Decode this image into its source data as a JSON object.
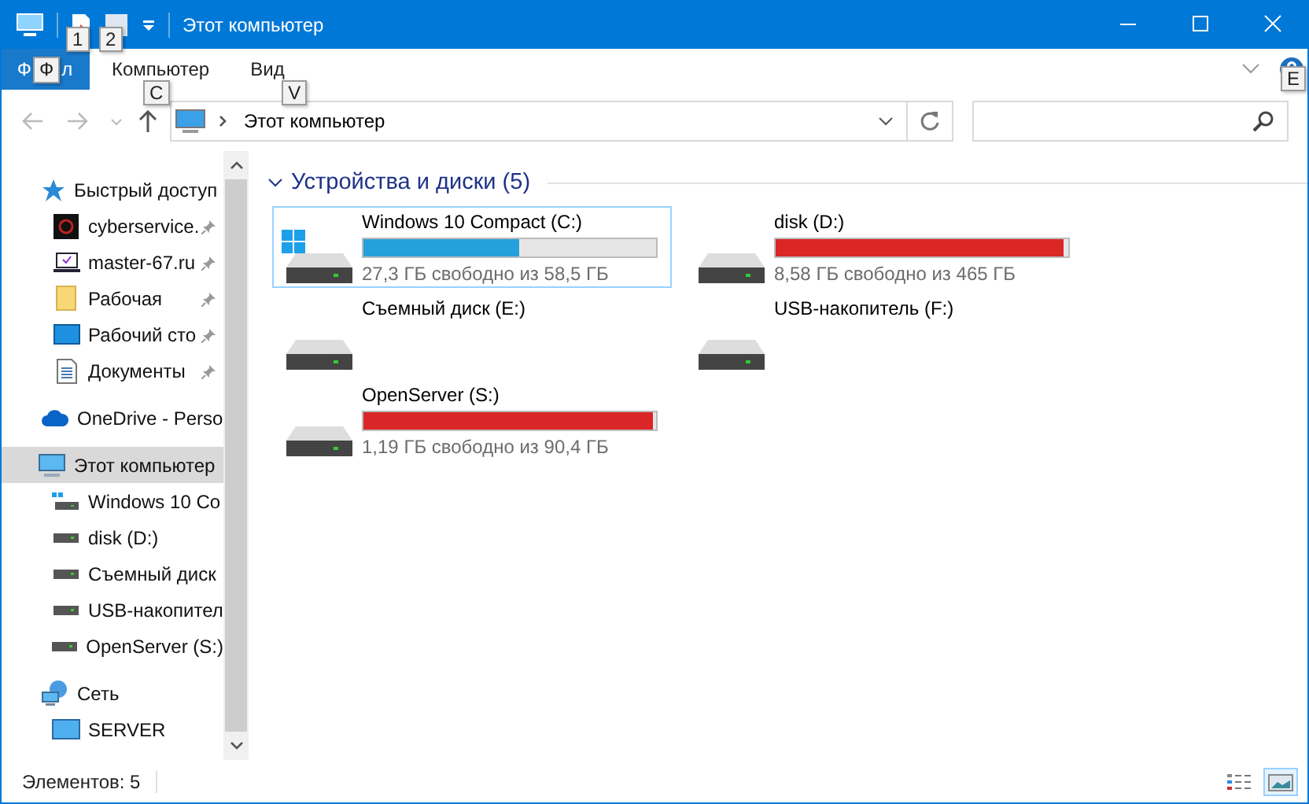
{
  "window": {
    "title": "Этот компьютер"
  },
  "quick_access_toolbar": [
    {
      "kind": "properties",
      "keytip": "1"
    },
    {
      "kind": "new-folder",
      "keytip": "2"
    }
  ],
  "ribbon": {
    "tabs": [
      {
        "kind": "file",
        "label_start": "Ф",
        "keytip": "Ф",
        "label_end": "л"
      },
      {
        "kind": "tab",
        "label": "Компьютер",
        "keytip": "C"
      },
      {
        "kind": "tab",
        "label": "Вид",
        "keytip": "V"
      }
    ],
    "help_keytip": "E"
  },
  "address": {
    "path": "Этот компьютер"
  },
  "navigation": [
    {
      "kind": "quick-access",
      "label": "Быстрый доступ",
      "selected": false,
      "children": [
        {
          "kind": "site",
          "label": "cyberservice.",
          "pinned": true
        },
        {
          "kind": "laptop",
          "label": "master-67.ru",
          "pinned": true
        },
        {
          "kind": "folder",
          "label": "Рабочая",
          "pinned": true
        },
        {
          "kind": "desktop",
          "label": "Рабочий сто",
          "pinned": true
        },
        {
          "kind": "documents",
          "label": "Документы",
          "pinned": true
        }
      ]
    },
    {
      "kind": "onedrive",
      "label": "OneDrive - Perso",
      "selected": false
    },
    {
      "kind": "pc",
      "label": "Этот компьютер",
      "selected": true,
      "children": [
        {
          "kind": "drive-windows",
          "label": "Windows 10 Co",
          "pinned": false
        },
        {
          "kind": "drive",
          "label": "disk (D:)",
          "pinned": false
        },
        {
          "kind": "drive",
          "label": "Съемный диск",
          "pinned": false
        },
        {
          "kind": "drive",
          "label": "USB-накопител",
          "pinned": false
        },
        {
          "kind": "drive",
          "label": "OpenServer (S:)",
          "pinned": false
        }
      ]
    },
    {
      "kind": "network",
      "label": "Сеть",
      "selected": false,
      "children": [
        {
          "kind": "monitor",
          "label": "SERVER",
          "pinned": false
        }
      ]
    }
  ],
  "content": {
    "group_title": "Устройства и диски (5)",
    "expanded": true,
    "drives": [
      {
        "kind": "system",
        "name": "Windows 10 Compact (C:)",
        "level": 0.533,
        "low_space": false,
        "free": "27,3 ГБ свободно из 58,5 ГБ",
        "selected": true
      },
      {
        "kind": "disk",
        "name": "disk (D:)",
        "level": 0.982,
        "low_space": true,
        "free": "8,58 ГБ свободно из 465 ГБ",
        "selected": false
      },
      {
        "kind": "removable",
        "name": "Съемный диск (E:)",
        "selected": false
      },
      {
        "kind": "removable",
        "name": "USB-накопитель (F:)",
        "selected": false
      },
      {
        "kind": "disk",
        "name": "OpenServer (S:)",
        "level": 0.987,
        "low_space": true,
        "free": "1,19 ГБ свободно из 90,4 ГБ",
        "selected": false
      }
    ]
  },
  "status_bar": {
    "items_count": "Элементов: 5",
    "views": [
      {
        "kind": "details",
        "selected": false
      },
      {
        "kind": "large-icons",
        "selected": true
      }
    ]
  }
}
